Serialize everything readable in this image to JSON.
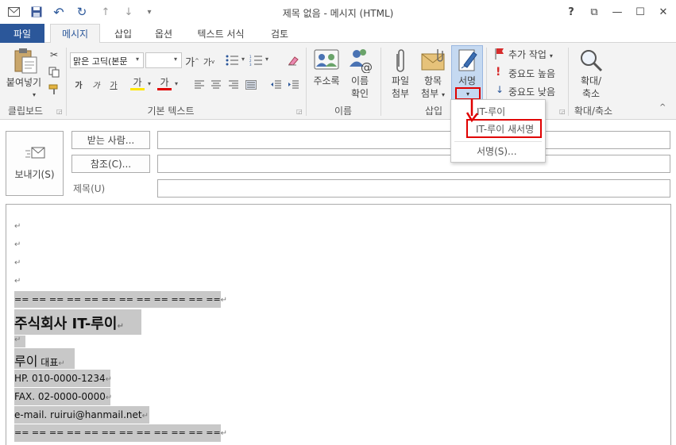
{
  "window": {
    "title": "제목 없음 - 메시지 (HTML)",
    "help": "?",
    "restore_ribbon": "⧉",
    "minimize": "—",
    "maximize": "☐",
    "close": "✕"
  },
  "quick_access": {
    "undo": "↶",
    "redo": "↻",
    "up": "↑",
    "down": "↓",
    "more": "▾"
  },
  "tabs": [
    {
      "label": "파일"
    },
    {
      "label": "메시지"
    },
    {
      "label": "삽입"
    },
    {
      "label": "옵션"
    },
    {
      "label": "텍스트 서식"
    },
    {
      "label": "검토"
    }
  ],
  "ribbon": {
    "clipboard": {
      "paste_label": "붙여넣기",
      "group_label": "클립보드"
    },
    "font": {
      "font_name": "맑은 고딕(본문",
      "font_size": "",
      "grow": "가",
      "shrink": "가",
      "bold": "가",
      "italic": "가",
      "underline": "가",
      "highlight": "가",
      "color": "가",
      "group_label": "기본 텍스트"
    },
    "names": {
      "address_book": "주소록",
      "check_names_1": "이름",
      "check_names_2": "확인",
      "group_label": "이름"
    },
    "insert": {
      "attach_1": "파일",
      "attach_2": "첨부",
      "item_1": "항목",
      "item_2": "첨부",
      "signature": "서명",
      "group_label": "삽입"
    },
    "tags": {
      "follow_up": "추가 작업",
      "high": "중요도 높음",
      "low": "중요도 낮음"
    },
    "zoom": {
      "label_1": "확대/",
      "label_2": "축소",
      "group_label": "확대/축소"
    }
  },
  "signature_menu": {
    "items": [
      {
        "label": "IT-루이"
      },
      {
        "label": "IT-루이 새서명"
      },
      {
        "label": "서명(S)..."
      }
    ]
  },
  "form": {
    "send": "보내기(S)",
    "to": "받는 사람...",
    "cc": "참조(C)...",
    "subject": "제목(U)"
  },
  "body": {
    "return_mark": "↵",
    "separator": "== == == == == == == == == == == ==",
    "company": "주식회사 IT-루이",
    "name": "루이",
    "position": "대표",
    "phone": "HP. 010-0000-1234",
    "fax": "FAX. 02-0000-0000",
    "email": "e-mail. ruirui@hanmail.net"
  },
  "colors": {
    "accent": "#2b579a",
    "highlight_red": "#e00000",
    "selection": "#c8c8c8"
  }
}
